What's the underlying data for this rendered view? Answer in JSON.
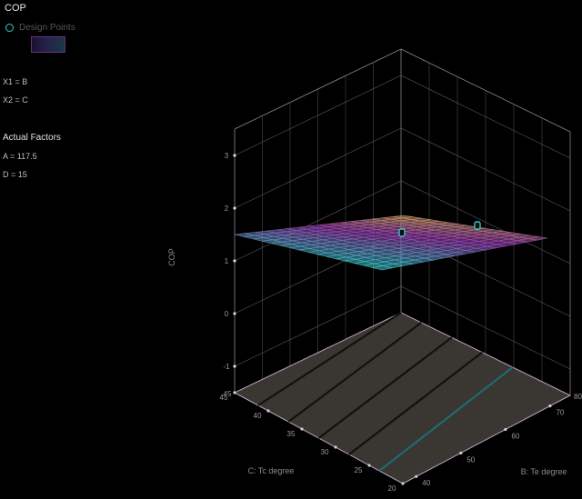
{
  "legend": {
    "title": "COP",
    "marker_label": "Design Points"
  },
  "factors": {
    "x1": "X1 = B",
    "x2": "X2 = C",
    "actual_heading": "Actual Factors",
    "a_value": "A = 117.5",
    "d_value": "D = 15"
  },
  "chart_data": {
    "type": "surface-3d",
    "title": "COP",
    "zlabel": "COP",
    "xlabel": "C: Tc degree",
    "ylabel": "B: Te degree",
    "z_ticks": [
      "-1",
      "0",
      "1",
      "2",
      "3"
    ],
    "zlim": [
      -1,
      3
    ],
    "c_axis_ticks": [
      "45",
      "40",
      "35",
      "30",
      "25",
      "20"
    ],
    "b_axis_ticks": [
      "40",
      "50",
      "60",
      "70"
    ],
    "c_range": [
      20,
      45
    ],
    "b_range": [
      40,
      70
    ],
    "surface_note": "nearly flat response surface around COP 0.7-1.0, color graded cyan (low) to yellow (high)",
    "design_points": [
      {
        "label": "Design Points",
        "cop": 0.95
      },
      {
        "label": "Design Points",
        "cop": 0.85
      }
    ],
    "grid": true,
    "colors": {
      "low": "#2fd0c8",
      "mid": "#9b3fb5",
      "high": "#d8c83a",
      "floor": "#3a3632",
      "grid": "#5a5a5a"
    }
  }
}
